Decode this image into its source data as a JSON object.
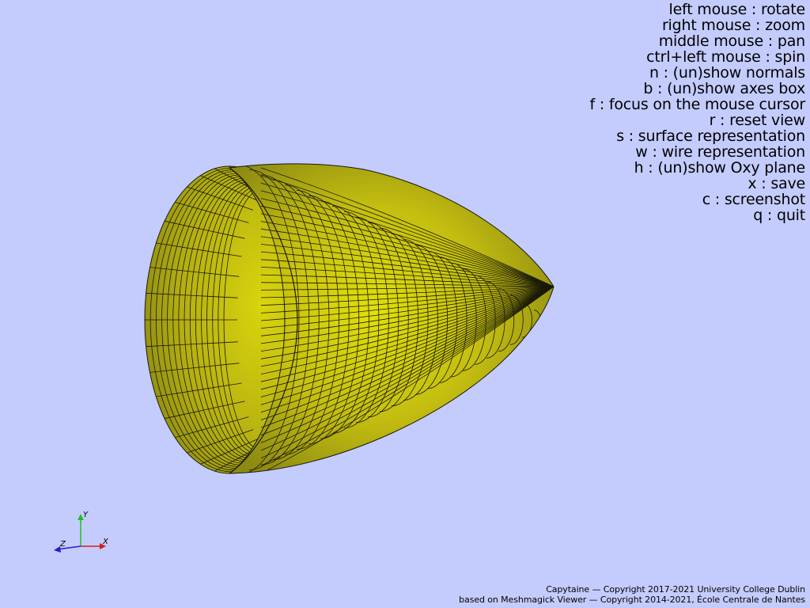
{
  "controls": [
    "left mouse : rotate",
    "right mouse : zoom",
    "middle mouse : pan",
    "ctrl+left mouse : spin",
    "n : (un)show normals",
    "b : (un)show axes box",
    "f : focus on the mouse cursor",
    "r : reset view",
    "s : surface representation",
    "w : wire representation",
    "h : (un)show Oxy plane",
    "x : save",
    "c : screenshot",
    "q : quit"
  ],
  "credits": {
    "line1": "Capytaine — Copyright 2017-2021 University College Dublin",
    "line2": "based on Meshmagick Viewer — Copyright 2014-2021, École Centrale de Nantes"
  },
  "axes": {
    "x": "X",
    "y": "Y",
    "z": "Z"
  },
  "colors": {
    "background": "#c4ccfd",
    "mesh_face": "#b0ab12",
    "mesh_edges": "#1a1a06",
    "axis_x": "#d02020",
    "axis_y": "#20c020",
    "axis_z": "#2020d0"
  }
}
